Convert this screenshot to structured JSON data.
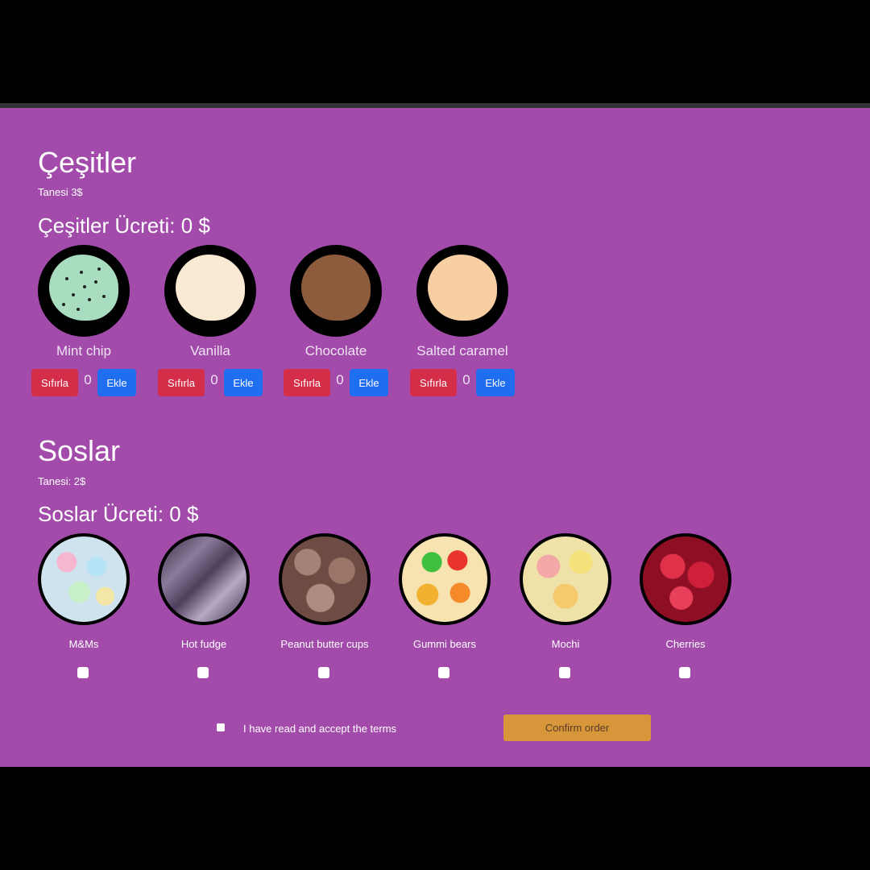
{
  "flavors_section": {
    "title": "Çeşitler",
    "unit_price": "Tanesi 3$",
    "fee_label": "Çeşitler Ücreti: 0 $",
    "items": [
      {
        "name": "Mint chip",
        "count": "0",
        "reset_label": "Sıfırla",
        "add_label": "Ekle",
        "color": "#a8ddc0"
      },
      {
        "name": "Vanilla",
        "count": "0",
        "reset_label": "Sıfırla",
        "add_label": "Ekle",
        "color": "#fbead3"
      },
      {
        "name": "Chocolate",
        "count": "0",
        "reset_label": "Sıfırla",
        "add_label": "Ekle",
        "color": "#8d5c3c"
      },
      {
        "name": "Salted caramel",
        "count": "0",
        "reset_label": "Sıfırla",
        "add_label": "Ekle",
        "color": "#f8cfa3"
      }
    ]
  },
  "toppings_section": {
    "title": "Soslar",
    "unit_price": "Tanesi: 2$",
    "fee_label": "Soslar Ücreti: 0 $",
    "items": [
      {
        "name": "M&Ms",
        "checked": false,
        "color": "#cfe3ef"
      },
      {
        "name": "Hot fudge",
        "checked": false,
        "color": "#5b4c66"
      },
      {
        "name": "Peanut butter cups",
        "checked": false,
        "color": "#7c5a52"
      },
      {
        "name": "Gummi bears",
        "checked": false,
        "color": "#e9a53a"
      },
      {
        "name": "Mochi",
        "checked": false,
        "color": "#e9d88a"
      },
      {
        "name": "Cherries",
        "checked": false,
        "color": "#b5162f"
      }
    ]
  },
  "footer": {
    "terms_label": "I have read and accept the terms",
    "terms_checked": false,
    "confirm_label": "Confirm order"
  },
  "colors": {
    "background": "#a24bab",
    "reset_button": "#d42e48",
    "add_button": "#1f6ef0",
    "confirm_button": "#d7963a"
  }
}
